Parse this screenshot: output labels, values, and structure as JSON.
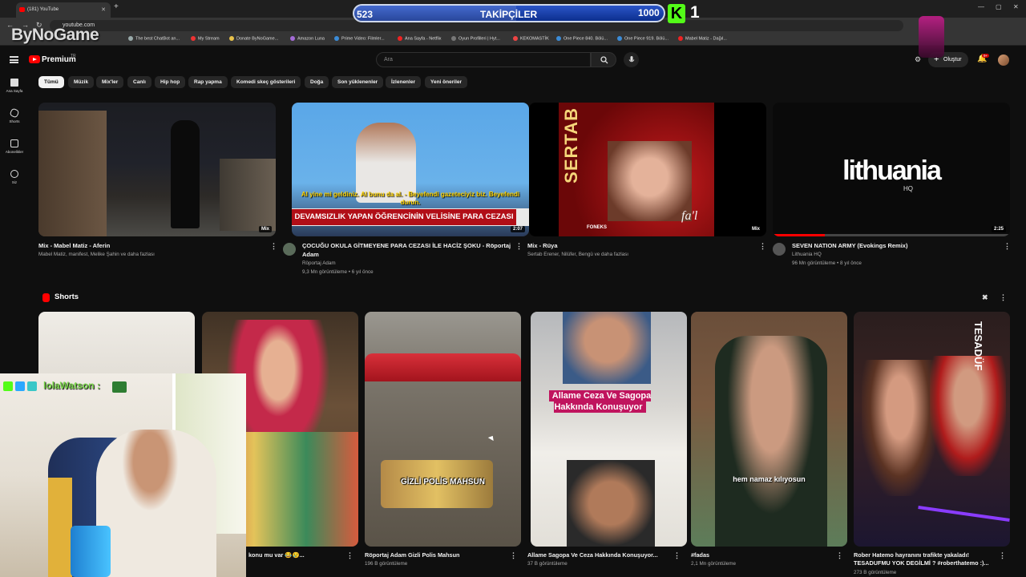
{
  "browser": {
    "tab_title": "(181) YouTube",
    "url": "youtube.com",
    "bookmarks": [
      "The best ChatBot an...",
      "My Stream",
      "Donate ByNoGame...",
      "Amazon Luna",
      "Prime Video: Filmler...",
      "Ana Sayfa - Netflix",
      "Oyun Profilleri | Hyt...",
      "KEKOMASTİK",
      "One Piece 840. Bölü...",
      "One Piece 919. Bölü...",
      "Mabel Matiz - Dağıl..."
    ]
  },
  "overlay": {
    "watermark": "ByNoGame",
    "follow_label": "TAKİPÇİLER",
    "follow_current": "523",
    "follow_goal": "1000",
    "follow_progress": 0.523,
    "kick_logo": "K",
    "kick_count": "1",
    "chat_username": "lolaWatson :"
  },
  "header": {
    "brand": "Premium",
    "country": "TR",
    "search_placeholder": "Ara",
    "create_label": "Oluştur",
    "notifications": "9+"
  },
  "sidebar": [
    {
      "label": "Ana Sayfa",
      "icon": "home-icon"
    },
    {
      "label": "Shorts",
      "icon": "shorts-icon"
    },
    {
      "label": "Abonelikler",
      "icon": "subscriptions-icon"
    },
    {
      "label": "Siz",
      "icon": "you-icon"
    }
  ],
  "chips": [
    "Tümü",
    "Müzik",
    "Mix'ler",
    "Canlı",
    "Hip hop",
    "Rap yapma",
    "Komedi skeç gösterileri",
    "Doğa",
    "Son yüklenenler",
    "İzlenenler",
    "Yeni öneriler"
  ],
  "videos": [
    {
      "title": "Mix - Mabel Matiz - Aferin",
      "title2": "",
      "channel": "Mabel Matiz, manifest, Melike Şahin ve daha fazlası",
      "meta": "",
      "badge": "Mix"
    },
    {
      "title": "ÇOCUĞU OKULA GİTMEYENE PARA CEZASI İLE HACİZ ŞOKU - Röportaj",
      "title2": "Adam",
      "channel": "Röportaj Adam",
      "meta": "9,3 Mn görüntüleme • 6 yıl önce",
      "badge": "2:07",
      "banner": "DEVAMSIZLIK YAPAN ÖĞRENCİNİN VELİSİNE PARA CEZASI",
      "sub": "Al yine mi geldiniz. Al bunu da al. - Beyefendi gazeteciyiz biz. Beyefendi durun."
    },
    {
      "title": "Mix - Rüya",
      "title2": "",
      "channel": "Sertab Erener, Nilüfer, Bengü ve daha fazlası",
      "meta": "",
      "badge": "Mix",
      "cover_name": "SERTAB",
      "cover_label": "FONEKS",
      "cover_sig": "fa'l"
    },
    {
      "title": "SEVEN NATION ARMY (Evokings Remix)",
      "title2": "",
      "channel": "Lithuania HQ",
      "meta": "96 Mn görüntüleme • 8 yıl önce",
      "badge": "2:25",
      "logo": "lithuania",
      "logo_sub": "HQ"
    }
  ],
  "shorts": {
    "heading": "Shorts",
    "items": [
      {
        "title": "",
        "views": ""
      },
      {
        "title": "konu mu var 😂😢...",
        "views": ""
      },
      {
        "title": "Röportaj Adam Gizli Polis Mahsun",
        "views": "196 B görüntüleme",
        "caption": "GİZLİ POLİS MAHSUN"
      },
      {
        "title": "Allame Sagopa Ve Ceza Hakkında Konuşuyor...",
        "views": "37 B görüntüleme",
        "caption": "Allame Ceza Ve Sagopa Hakkında Konuşuyor"
      },
      {
        "title": "#fadas",
        "views": "2,1 Mn görüntüleme",
        "caption": "hem namaz kılıyosun"
      },
      {
        "title": "Rober Hatemo hayranını trafikte yakaladı! TESADUFMU YOK DEGİLMİ ? #roberthatemo :)...",
        "views": "273 B görüntüleme",
        "caption": "TESADÜF"
      }
    ]
  },
  "colors": {
    "accent": "#ff0000",
    "kick": "#53fc18",
    "bg": "#0f0f0f"
  }
}
